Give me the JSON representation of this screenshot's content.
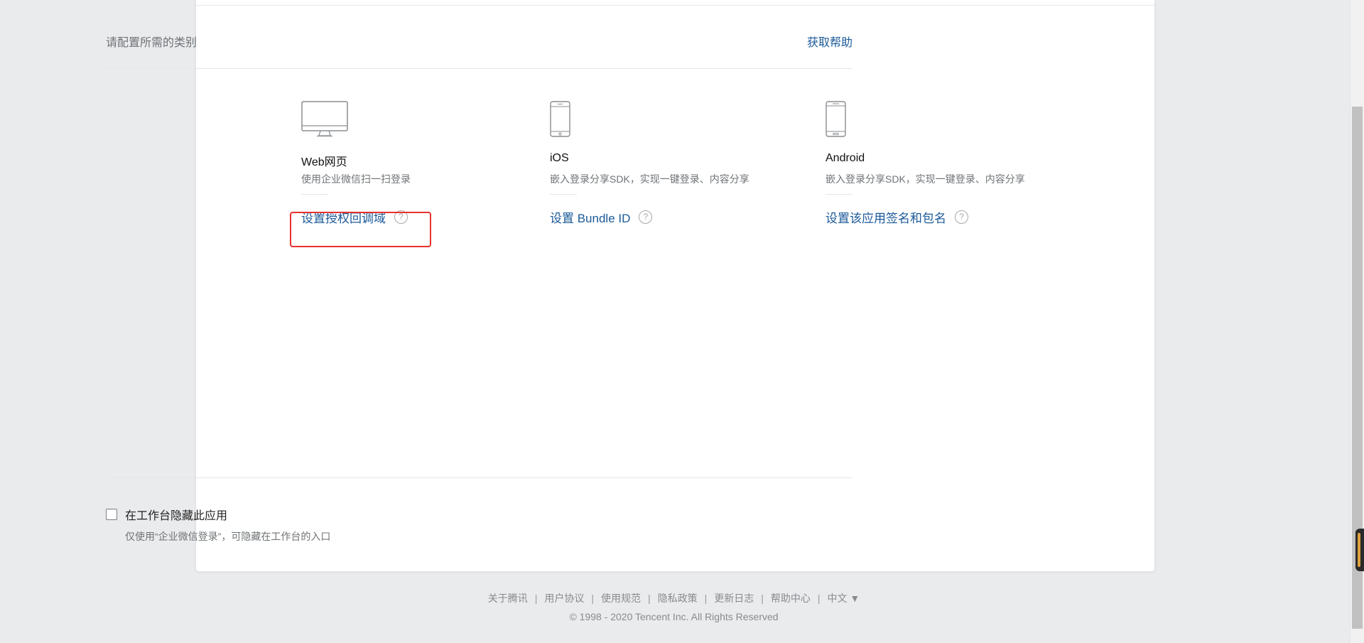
{
  "header": {
    "title": "请配置所需的类别",
    "help_link": "获取帮助"
  },
  "platforms": [
    {
      "icon": "desktop-monitor-icon",
      "name": "Web网页",
      "description": "使用企业微信扫一扫登录",
      "config_link": "设置授权回调域",
      "help_glyph": "?"
    },
    {
      "icon": "iphone-icon",
      "name": "iOS",
      "description": "嵌入登录分享SDK，实现一键登录、内容分享",
      "config_link": "设置 Bundle ID",
      "help_glyph": "?"
    },
    {
      "icon": "android-phone-icon",
      "name": "Android",
      "description": "嵌入登录分享SDK，实现一键登录、内容分享",
      "config_link": "设置该应用签名和包名",
      "help_glyph": "?"
    }
  ],
  "hide_option": {
    "checked": false,
    "label": "在工作台隐藏此应用",
    "hint": "仅使用“企业微信登录”，可隐藏在工作台的入口"
  },
  "footer": {
    "links": [
      "关于腾讯",
      "用户协议",
      "使用规范",
      "隐私政策",
      "更新日志",
      "帮助中心"
    ],
    "language": "中文 ▼",
    "copyright": "© 1998 - 2020 Tencent Inc. All Rights Reserved"
  },
  "colors": {
    "link": "#1b5998",
    "highlight": "#e8322e",
    "background": "#eaebed"
  }
}
